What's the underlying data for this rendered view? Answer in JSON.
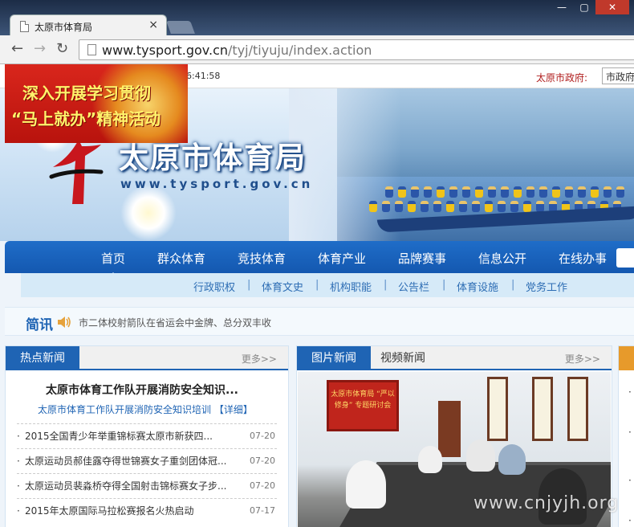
{
  "browser": {
    "tab_title": "太原市体育局",
    "tab_close": "×",
    "url_host": "www.tysport.gov.cn",
    "url_path": "/tyj/tiyuju/index.action"
  },
  "topbar": {
    "time": "6:41:58",
    "gov_label": "太原市政府:",
    "gov_select": "市政府"
  },
  "promo": {
    "line1": "深入开展学习贯彻",
    "line2": "“马上就办”精神活动"
  },
  "banner": {
    "site_title": "太原市体育局",
    "site_url": "www.tysport.gov.cn"
  },
  "main_nav": [
    "首页",
    "群众体育",
    "竞技体育",
    "体育产业",
    "品牌赛事",
    "信息公开",
    "在线办事"
  ],
  "sub_nav": [
    "行政职权",
    "体育文史",
    "机构职能",
    "公告栏",
    "体育设施",
    "党务工作"
  ],
  "sub_nav_separator": "|",
  "newsflash": {
    "label": "简讯",
    "text": "市二体校射箭队在省运会中金牌、总分双丰收"
  },
  "hot_news": {
    "tab": "热点新闻",
    "more": "更多>>",
    "headline": "太原市体育工作队开展消防安全知识...",
    "summary": "太原市体育工作队开展消防安全知识培训 【详细】",
    "items": [
      {
        "title": "2015全国青少年举重锦标赛太原市新获四...",
        "date": "07-20"
      },
      {
        "title": "太原运动员郝佳露夺得世锦赛女子重剑团体冠...",
        "date": "07-20"
      },
      {
        "title": "太原运动员裴淼桥夺得全国射击锦标赛女子步...",
        "date": "07-20"
      },
      {
        "title": "2015年太原国际马拉松赛报名火热启动",
        "date": "07-17"
      }
    ]
  },
  "photo_news": {
    "tab_active": "图片新闻",
    "tab_other": "视频新闻",
    "more": "更多>>",
    "photo_banner": "太原市体育局 “严以修身” 专题研讨会"
  },
  "watermark": "www.cnjyjh.org",
  "colors": {
    "nav_blue": "#1f64b4",
    "promo_red": "#d9261c",
    "accent_orange": "#e79a2b"
  }
}
